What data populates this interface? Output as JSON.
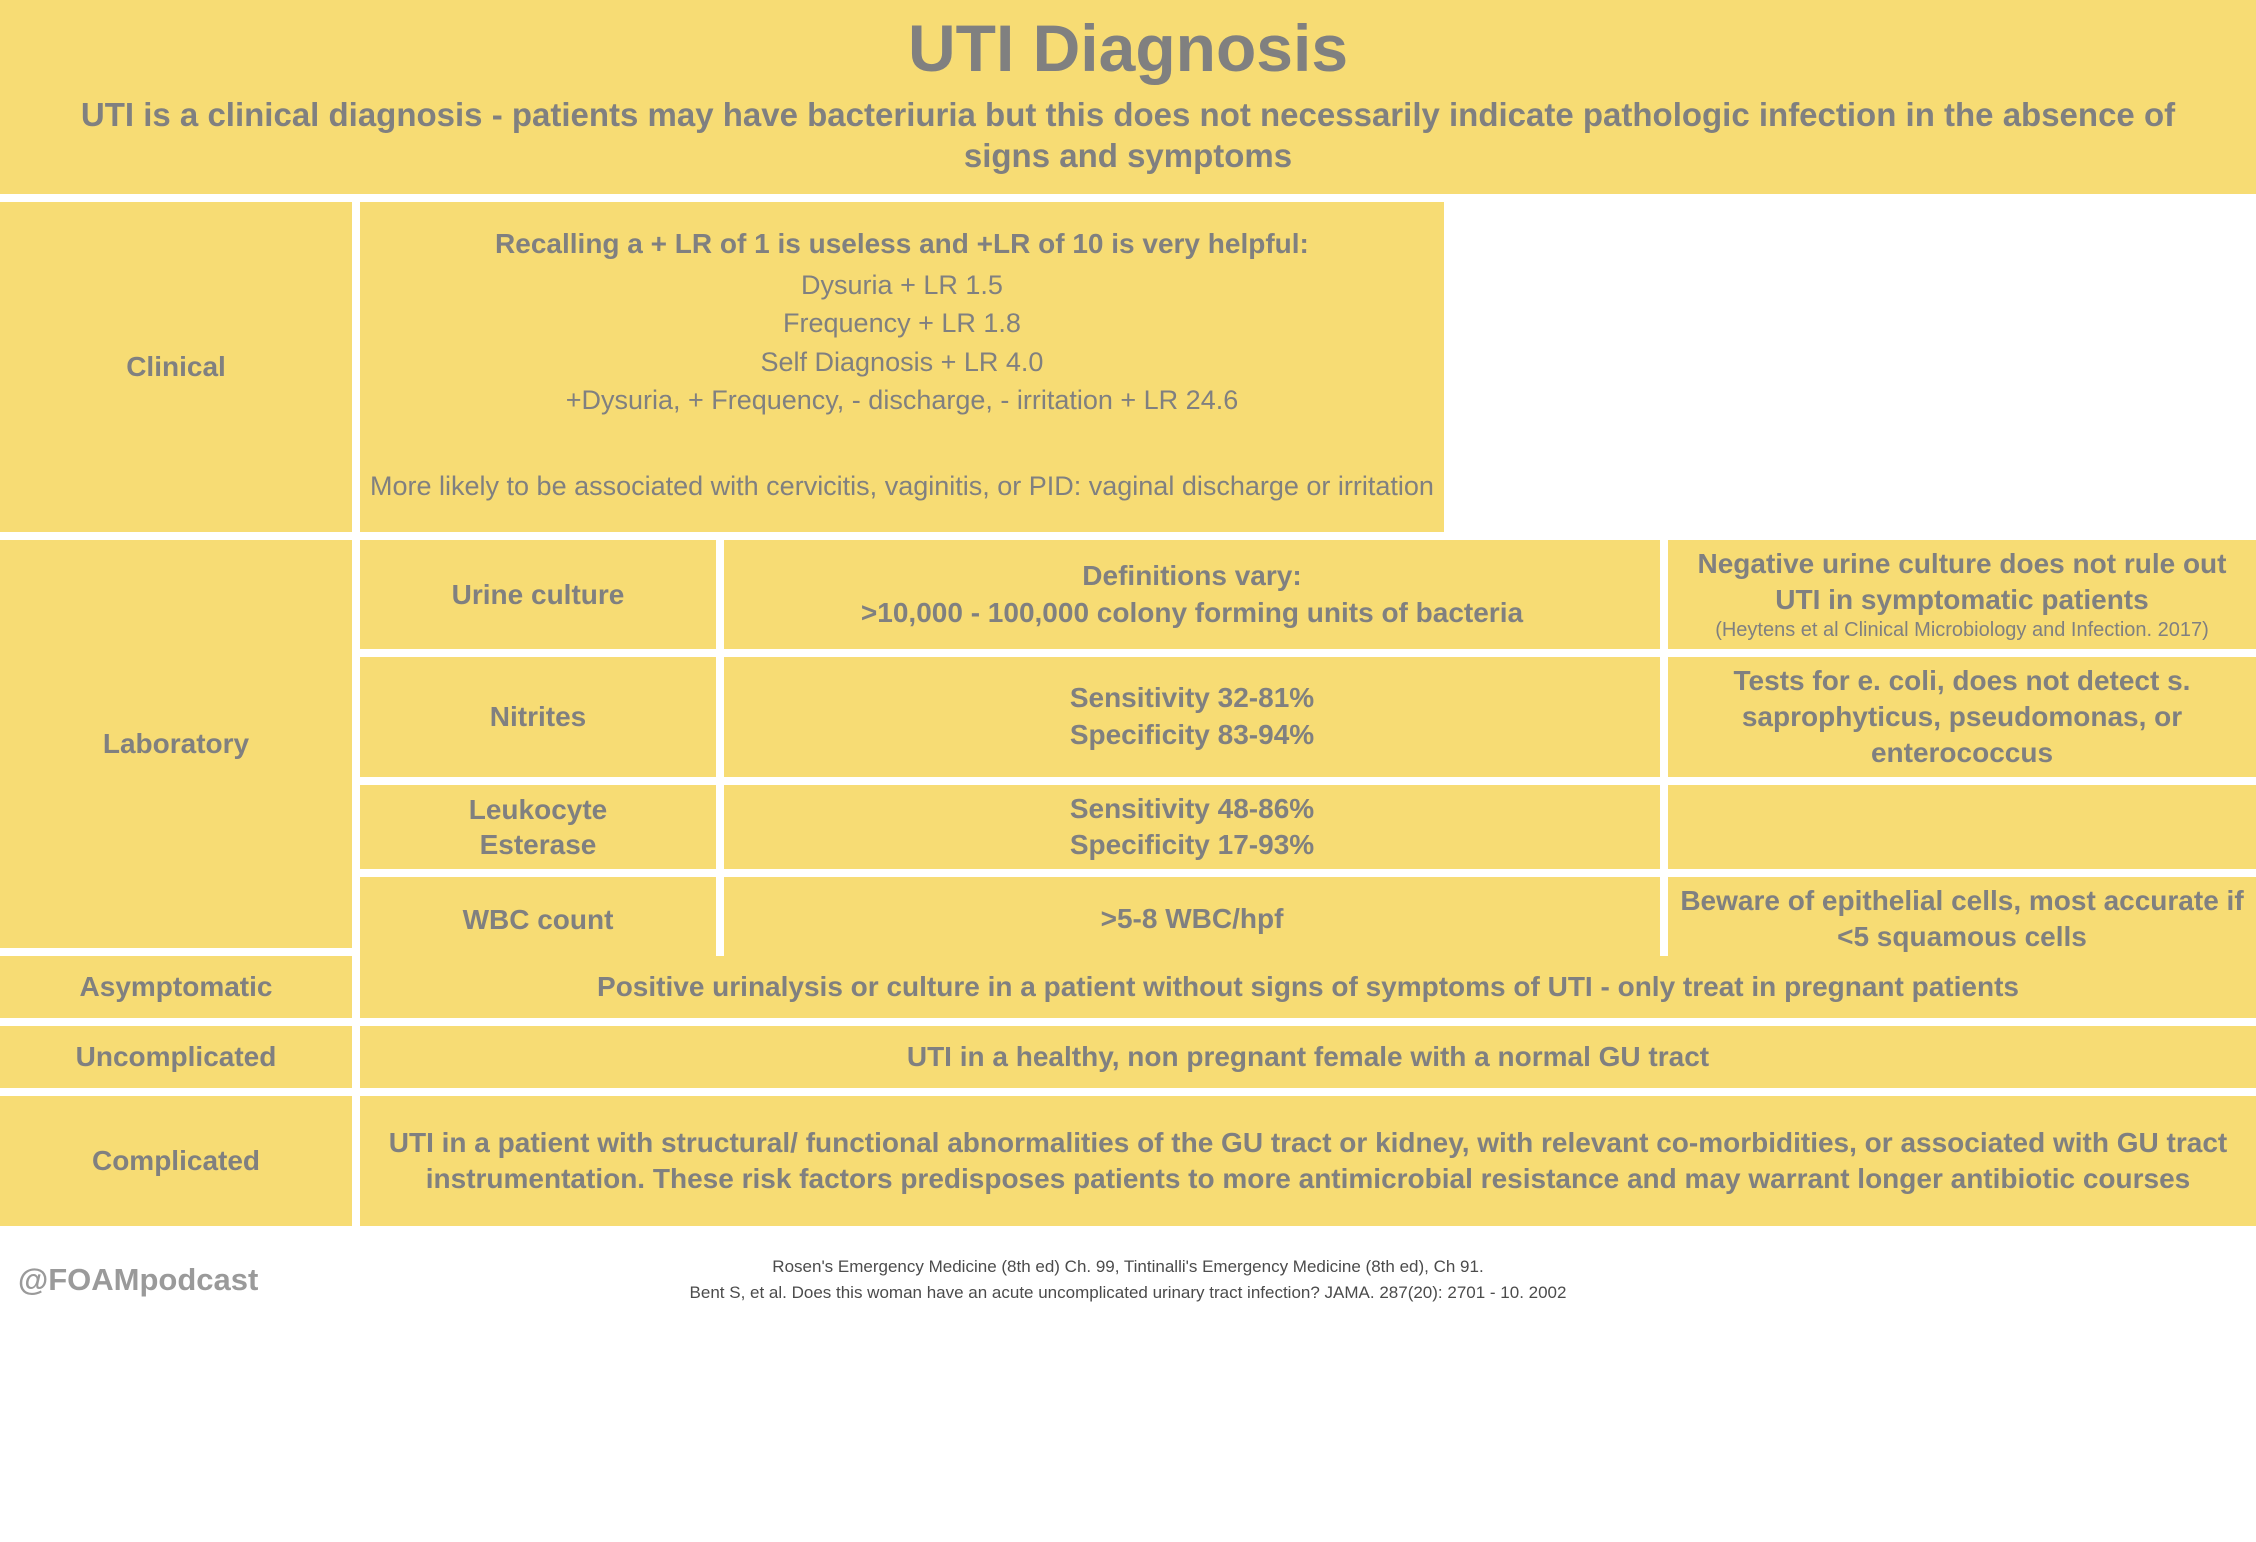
{
  "header": {
    "title": "UTI Diagnosis",
    "subtitle": "UTI is a clinical diagnosis - patients may have bacteriuria but this does not necessarily indicate pathologic infection in the absence of signs and symptoms"
  },
  "clinical": {
    "label": "Clinical",
    "lead": "Recalling a + LR of 1 is useless and +LR of 10 is very helpful:",
    "lr_items": [
      "Dysuria + LR 1.5",
      "Frequency + LR 1.8",
      "Self Diagnosis + LR 4.0",
      "+Dysuria, + Frequency, - discharge, - irritation + LR 24.6"
    ],
    "note": "More likely to be associated with cervicitis, vaginitis, or PID: vaginal discharge or irritation"
  },
  "laboratory": {
    "label": "Laboratory",
    "rows": [
      {
        "test": "Urine culture",
        "detail_line1": "Definitions vary:",
        "detail_line2": ">10,000 - 100,000 colony forming units of bacteria",
        "note": "Negative urine culture does not rule out UTI in symptomatic patients",
        "citation": "(Heytens et al Clinical Microbiology and Infection. 2017)"
      },
      {
        "test": "Nitrites",
        "detail_line1": "Sensitivity 32-81%",
        "detail_line2": "Specificity 83-94%",
        "note": "Tests for e. coli, does not detect s. saprophyticus, pseudomonas, or enterococcus",
        "citation": ""
      },
      {
        "test": "Leukocyte Esterase",
        "detail_line1": "Sensitivity 48-86%",
        "detail_line2": "Specificity 17-93%",
        "note": "",
        "citation": ""
      },
      {
        "test": "WBC count",
        "detail_line1": ">5-8 WBC/hpf",
        "detail_line2": "",
        "note": "Beware of epithelial cells, most accurate if <5 squamous cells",
        "citation": ""
      }
    ]
  },
  "categories": [
    {
      "label": "Asymptomatic",
      "text": "Positive urinalysis or culture in a patient without signs of symptoms of UTI - only treat in pregnant patients"
    },
    {
      "label": "Uncomplicated",
      "text": "UTI in a healthy, non pregnant female with a normal GU tract"
    },
    {
      "label": "Complicated",
      "text": "UTI in a patient with structural/ functional abnormalities of the GU tract or kidney, with relevant co-morbidities, or associated with GU tract instrumentation. These risk factors predisposes patients to more antimicrobial resistance and may warrant longer antibiotic courses"
    }
  ],
  "footer": {
    "handle": "@FOAMpodcast",
    "reference_line1": "Rosen's Emergency Medicine (8th ed) Ch. 99, Tintinalli's Emergency Medicine (8th ed), Ch 91.",
    "reference_line2": "Bent S, et al. Does this woman have an acute uncomplicated urinary tract infection? JAMA. 287(20): 2701 -  10. 2002"
  },
  "colors": {
    "cell_background": "#f7dc74",
    "text": "#808080",
    "page_background": "#ffffff"
  }
}
